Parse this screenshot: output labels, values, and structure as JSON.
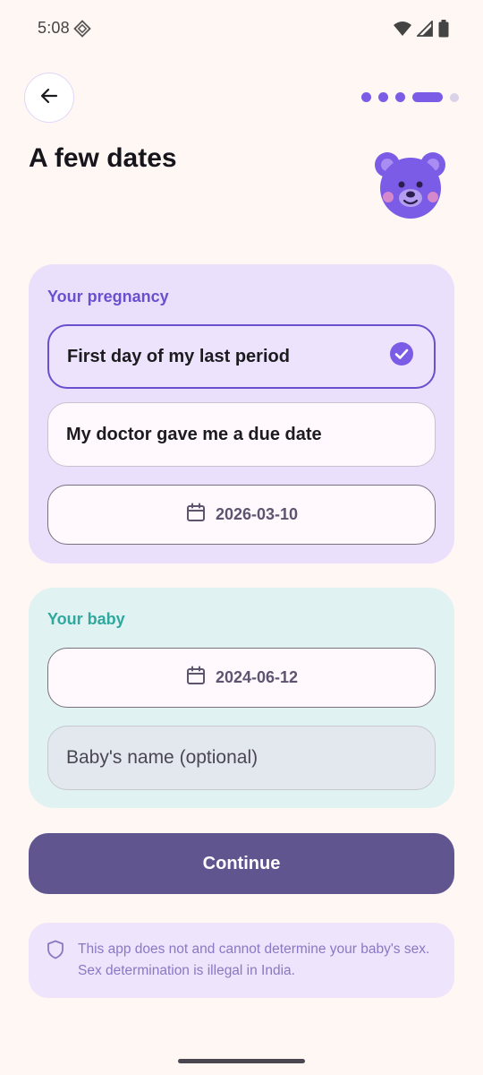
{
  "status_bar": {
    "time": "5:08"
  },
  "header": {
    "title": "A few dates",
    "progress": {
      "total_steps": 5,
      "current_step": 4
    }
  },
  "pregnancy": {
    "label": "Your pregnancy",
    "options": [
      {
        "label": "First day of my last period",
        "selected": true
      },
      {
        "label": "My doctor gave me a due date",
        "selected": false
      }
    ],
    "date": "2026-03-10"
  },
  "baby": {
    "label": "Your baby",
    "date": "2024-06-12",
    "name_placeholder": "Baby's name (optional)"
  },
  "actions": {
    "continue_label": "Continue"
  },
  "disclaimer": {
    "text": "This app does not and cannot determine your baby's sex. Sex determination is illegal in India."
  },
  "colors": {
    "background": "#FFF7F3",
    "accent": "#6A4FCF",
    "pregnancy_card": "#EAE0FB",
    "baby_card": "#E1F2F3",
    "baby_accent": "#2FA89D",
    "primary_button": "#61558F"
  },
  "icons": [
    "back-arrow-icon",
    "check-circle-icon",
    "calendar-icon",
    "shield-icon",
    "bear-mascot",
    "wifi-icon",
    "signal-icon",
    "battery-icon"
  ]
}
